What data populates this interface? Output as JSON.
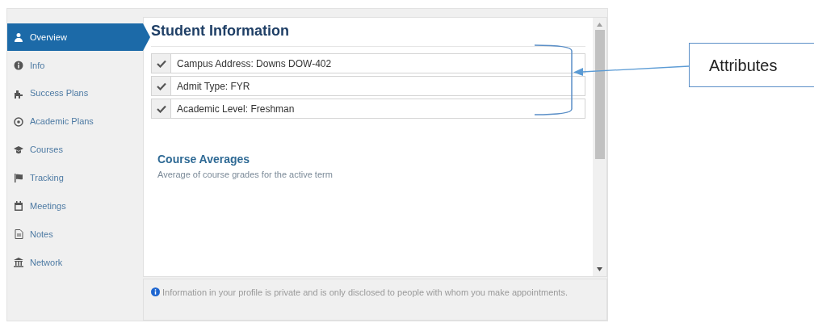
{
  "sidebar": {
    "items": [
      {
        "label": "Overview",
        "selected": true
      },
      {
        "label": "Info",
        "selected": false
      },
      {
        "label": "Success Plans",
        "selected": false
      },
      {
        "label": "Academic Plans",
        "selected": false
      },
      {
        "label": "Courses",
        "selected": false
      },
      {
        "label": "Tracking",
        "selected": false
      },
      {
        "label": "Meetings",
        "selected": false
      },
      {
        "label": "Notes",
        "selected": false
      },
      {
        "label": "Network",
        "selected": false
      }
    ]
  },
  "main": {
    "title": "Student Information",
    "attributes": [
      {
        "text": "Campus Address: Downs DOW-402",
        "checked": true
      },
      {
        "text": "Admit Type: FYR",
        "checked": true
      },
      {
        "text": "Academic Level: Freshman",
        "checked": true
      }
    ],
    "section": {
      "title": "Course Averages",
      "subtitle": "Average of course grades for the active term"
    }
  },
  "footer": {
    "text": "Information in your profile is private and is only disclosed to people with whom you make appointments."
  },
  "callout": {
    "label": "Attributes"
  }
}
